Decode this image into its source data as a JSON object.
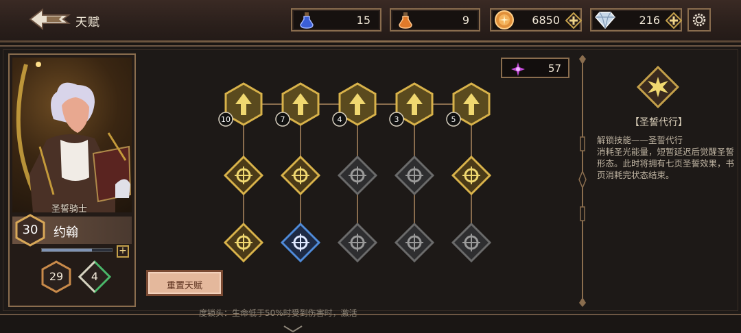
{
  "header": {
    "title": "天赋",
    "resources": [
      {
        "name": "blue-potion",
        "value": "15"
      },
      {
        "name": "orange-potion",
        "value": "9"
      },
      {
        "name": "gold-coin",
        "value": "6850"
      },
      {
        "name": "diamond",
        "value": "216"
      }
    ]
  },
  "character": {
    "class_name": "圣誓骑士",
    "level": "30",
    "name": "约翰",
    "xp_fraction": 0.72,
    "stats": [
      "29",
      "4"
    ]
  },
  "talent_points": "57",
  "tree": {
    "top_row_counts": [
      "10",
      "7",
      "4",
      "3",
      "5"
    ],
    "rows": [
      [
        "unlocked",
        "unlocked",
        "unlocked",
        "unlocked",
        "unlocked"
      ],
      [
        "unlocked",
        "unlocked",
        "locked",
        "locked",
        "unlocked"
      ],
      [
        "unlocked",
        "selected",
        "locked",
        "locked",
        "locked"
      ]
    ]
  },
  "reset_button": "重置天赋",
  "detail": {
    "title": "【圣誓代行】",
    "description": "解锁技能——圣誓代行\n消耗圣光能量，短暂延迟后觉醒圣誓形态。此时将拥有七页圣誓效果，书页消耗完状态结束。"
  },
  "bottom_hint": "度锁头：生命低于50%时受到伤害时，激活",
  "colors": {
    "gold": "#d8b24a",
    "frame": "#8a6d4e",
    "selected": "#4f8ad8",
    "locked": "#8a8a8a"
  }
}
